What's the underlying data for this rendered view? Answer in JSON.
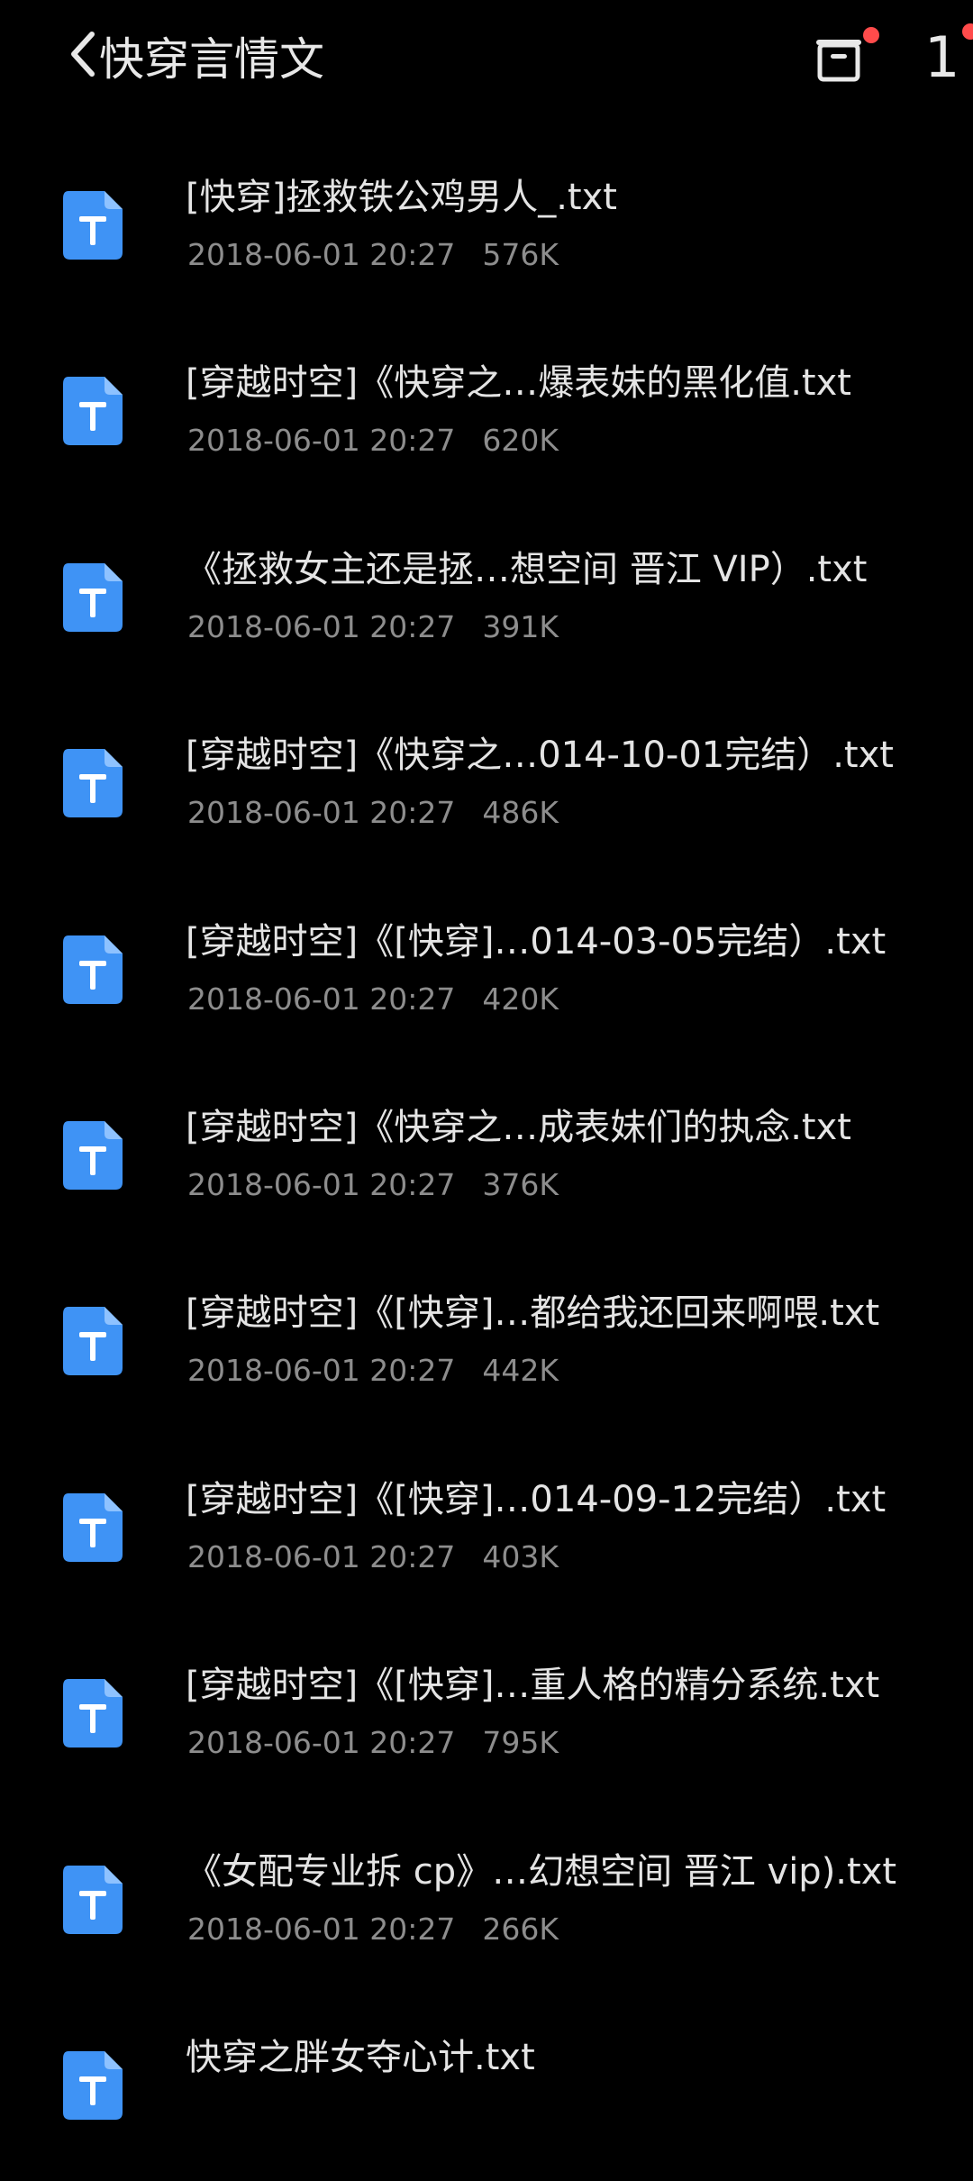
{
  "header": {
    "title": "快穿言情文",
    "counter": "1"
  },
  "files": [
    {
      "name": "[快穿]拯救铁公鸡男人_.txt",
      "date": "2018-06-01 20:27",
      "size": "576K"
    },
    {
      "name": "[穿越时空]《快穿之…爆表妹的黑化值.txt",
      "date": "2018-06-01 20:27",
      "size": "620K"
    },
    {
      "name": "《拯救女主还是拯…想空间 晋江 VIP）.txt",
      "date": "2018-06-01 20:27",
      "size": "391K"
    },
    {
      "name": "[穿越时空]《快穿之…014-10-01完结）.txt",
      "date": "2018-06-01 20:27",
      "size": "486K"
    },
    {
      "name": "[穿越时空]《[快穿]…014-03-05完结）.txt",
      "date": "2018-06-01 20:27",
      "size": "420K"
    },
    {
      "name": "[穿越时空]《快穿之…成表妹们的执念.txt",
      "date": "2018-06-01 20:27",
      "size": "376K"
    },
    {
      "name": "[穿越时空]《[快穿]…都给我还回来啊喂.txt",
      "date": "2018-06-01 20:27",
      "size": "442K"
    },
    {
      "name": "[穿越时空]《[快穿]…014-09-12完结）.txt",
      "date": "2018-06-01 20:27",
      "size": "403K"
    },
    {
      "name": "[穿越时空]《[快穿]…重人格的精分系统.txt",
      "date": "2018-06-01 20:27",
      "size": "795K"
    },
    {
      "name": "《女配专业拆 cp》…幻想空间 晋江 vip).txt",
      "date": "2018-06-01 20:27",
      "size": "266K"
    },
    {
      "name": "快穿之胖女夺心计.txt",
      "date": "",
      "size": ""
    }
  ],
  "colors": {
    "background": "#000000",
    "icon_blue": "#3f93f5",
    "meta_gray": "#8d8d8d",
    "badge_red": "#ff4b4b"
  }
}
